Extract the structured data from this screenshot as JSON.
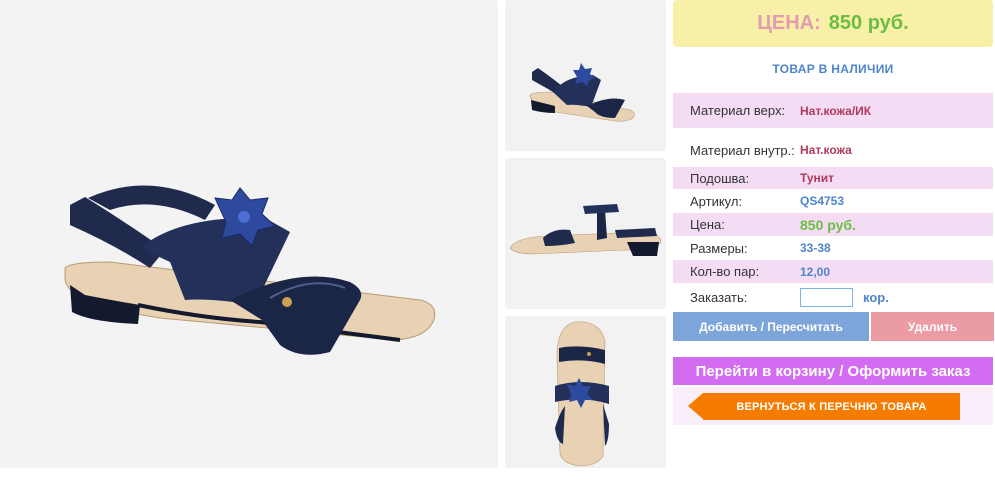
{
  "price_header": {
    "label": "ЦЕНА:",
    "value": "850 руб."
  },
  "stock_status": "ТОВАР В НАЛИЧИИ",
  "specs": [
    {
      "key": "Материал верх:",
      "value": "Нат.кожа/ИК"
    },
    {
      "key": "Материал внутр.:",
      "value": "Нат.кожа"
    },
    {
      "key": "Подошва:",
      "value": "Тунит"
    },
    {
      "key": "Артикул:",
      "value": "QS4753"
    },
    {
      "key": "Цена:",
      "value": "850 руб."
    },
    {
      "key": "Размеры:",
      "value": "33-38"
    },
    {
      "key": "Кол-во пар:",
      "value": "12,00"
    }
  ],
  "order": {
    "label": "Заказать:",
    "input_value": "",
    "unit": "кор."
  },
  "buttons": {
    "add": "Добавить / Пересчитать",
    "delete": "Удалить",
    "cart": "Перейти в корзину / Оформить заказ",
    "back": "ВЕРНУТЬСЯ К ПЕРЕЧНЮ ТОВАРА"
  },
  "colors": {
    "price_box_bg": "#f8f0a6",
    "price_label": "#e39bb0",
    "price_value": "#6cbd45",
    "accent_blue": "#4d85c9",
    "pink_row": "#f5dcf5",
    "cart_button": "#d36cf0",
    "back_button": "#f57c00",
    "sandal_navy": "#1f2a4d",
    "sole_beige": "#e8d2b3"
  }
}
